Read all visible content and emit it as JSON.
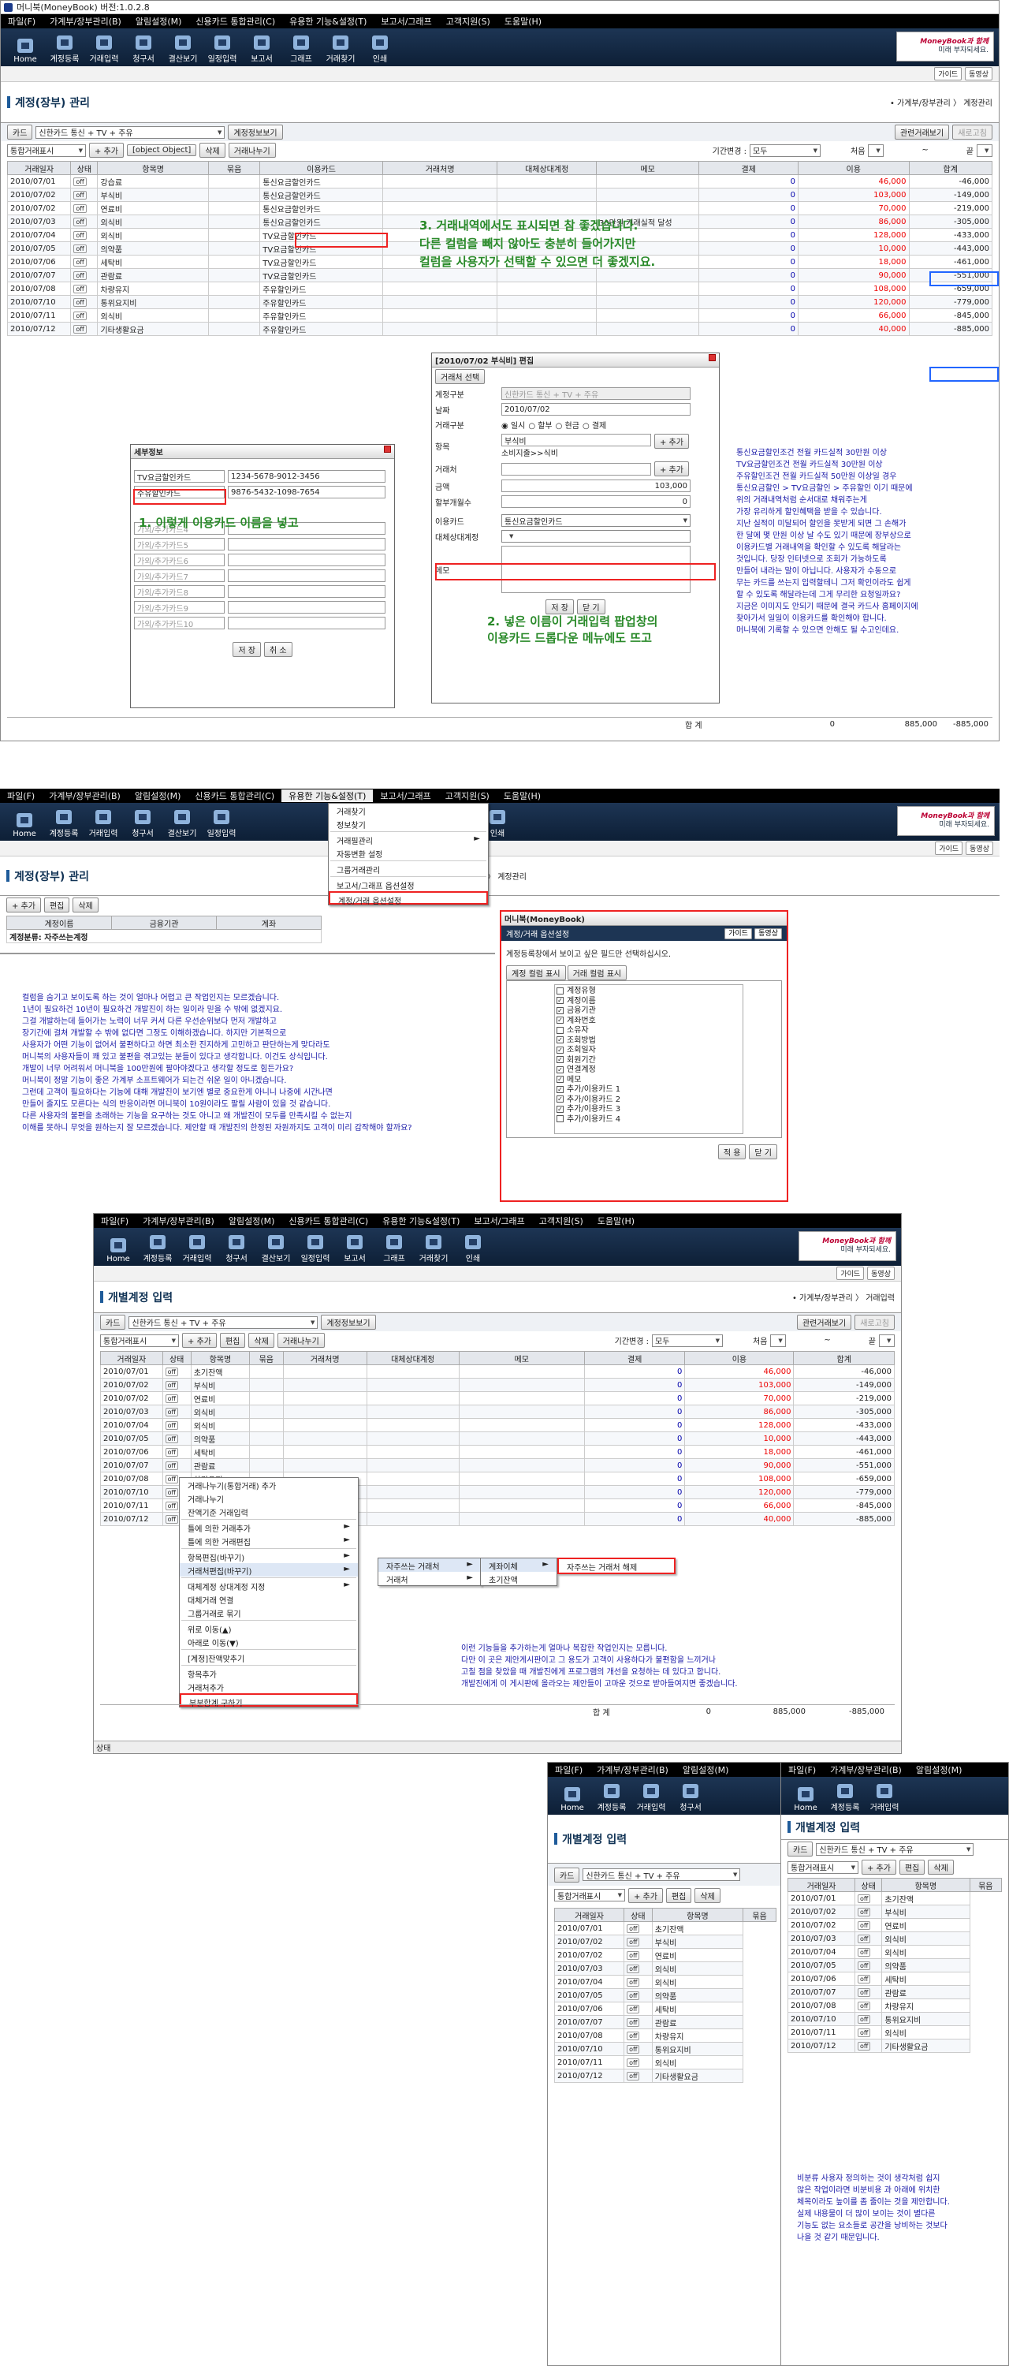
{
  "window_title": "머니북(MoneyBook) 버전:1.0.2.8",
  "menu": [
    "파일(F)",
    "가계부/장부관리(B)",
    "알림설정(M)",
    "신용카드 통합관리(C)",
    "유용한 기능&설정(T)",
    "보고서/그래프",
    "고객지원(S)",
    "도움말(H)"
  ],
  "toolbar": [
    "Home",
    "계정등록",
    "거래입력",
    "청구서",
    "결산보기",
    "일정입력",
    "보고서",
    "그래프",
    "거래찾기",
    "인쇄"
  ],
  "brand": {
    "line1": "MoneyBook과 함께",
    "line2": "미래 부자되세요."
  },
  "subbar": {
    "guide": "가이드",
    "video": "동영상"
  },
  "s1": {
    "title": "계정(장부) 관리",
    "breadcrumb": "• 가계부/장부관리 〉 계정관리",
    "card_btn": "카드",
    "card_select": "신한카드 통신 + TV + 주유",
    "card_view_btn": "계정정보보기",
    "new_btn": "관련거래보기",
    "refresh_btn": "새로고침",
    "filter_select": "통합거래표시",
    "add": "+ 추가",
    "edit": {
      "title": "[2010/07/02 부식비] 편집",
      "tab": "거래처 선택",
      "acct_label": "계정구분",
      "acct_val": "신한카드 통신 + TV + 주유",
      "date_label": "날짜",
      "date_val": "2010/07/02",
      "type_label": "거래구분",
      "types": [
        "일시",
        "할부",
        "현금",
        "결제"
      ],
      "item_label": "항목",
      "item_val": "부식비",
      "item_path": "소비지출>>식비",
      "vendor_label": "거래처",
      "amount_label": "금액",
      "amount_val": "103,000",
      "inst_label": "할부개월수",
      "inst_val": "0",
      "card_label": "이용카드",
      "card_val": "통신요금할인카드",
      "alt_label": "대체상대계정",
      "memo_label": "메모",
      "add": "+ 추가",
      "save": "저 장",
      "close": "닫 기",
      "annot": [
        "2. 넣은 이름이 거래입력 팝업창의",
        "이용카드 드롭다운 메뉴에도 뜨고"
      ]
    },
    "del": "삭제",
    "split": "거래나누기",
    "period_label": "기간변경 :",
    "period_val": "모두",
    "first": "처음",
    "tilde": "~",
    "end": "끝",
    "headers": [
      "거래일자",
      "상태",
      "항목명",
      "묶음",
      "이용카드",
      "거래처명",
      "대체상대계정",
      "메모",
      "결제",
      "이용",
      "합계"
    ],
    "rows": [
      [
        "2010/07/01",
        "off",
        "강습료",
        "",
        "통신요금할인카드",
        "",
        "",
        "",
        "0",
        "46,000",
        "-46,000"
      ],
      [
        "2010/07/02",
        "off",
        "부식비",
        "",
        "통신요금할인카드",
        "",
        "",
        "",
        "0",
        "103,000",
        "-149,000"
      ],
      [
        "2010/07/02",
        "off",
        "연료비",
        "",
        "통신요금할인카드",
        "",
        "",
        "",
        "0",
        "70,000",
        "-219,000"
      ],
      [
        "2010/07/03",
        "off",
        "외식비",
        "",
        "통신요금할인카드",
        "",
        "",
        "30만원 거래실적 달성",
        "0",
        "86,000",
        "-305,000"
      ],
      [
        "2010/07/04",
        "off",
        "외식비",
        "",
        "TV요금할인카드",
        "",
        "",
        "",
        "0",
        "128,000",
        "-433,000"
      ],
      [
        "2010/07/05",
        "off",
        "의약품",
        "",
        "TV요금할인카드",
        "",
        "",
        "",
        "0",
        "10,000",
        "-443,000"
      ],
      [
        "2010/07/06",
        "off",
        "세탁비",
        "",
        "TV요금할인카드",
        "",
        "",
        "",
        "0",
        "18,000",
        "-461,000"
      ],
      [
        "2010/07/07",
        "off",
        "관람료",
        "",
        "TV요금할인카드",
        "",
        "",
        "",
        "0",
        "90,000",
        "-551,000"
      ],
      [
        "2010/07/08",
        "off",
        "차량유지",
        "",
        "주유할인카드",
        "",
        "",
        "",
        "0",
        "108,000",
        "-659,000"
      ],
      [
        "2010/07/10",
        "off",
        "통위요지비",
        "",
        "주유할인카드",
        "",
        "",
        "",
        "0",
        "120,000",
        "-779,000"
      ],
      [
        "2010/07/11",
        "off",
        "외식비",
        "",
        "주유할인카드",
        "",
        "",
        "",
        "0",
        "66,000",
        "-845,000"
      ],
      [
        "2010/07/12",
        "off",
        "기타생활요금",
        "",
        "주유할인카드",
        "",
        "",
        "",
        "0",
        "40,000",
        "-885,000"
      ]
    ],
    "total_label": "합 계",
    "total_pay": "0",
    "total_use": "885,000",
    "total_sum": "-885,000",
    "annot1": [
      "3. 거래내역에서도 표시되면 참 좋겠습니다.",
      "다른 컬럼을 빼지 않아도 충분히 들어가지만",
      "컬럼을 사용자가 선택할 수 있으면 더 좋겠지요."
    ],
    "detail": {
      "title": "세부정보",
      "items": [
        [
          "TV요금할인카드",
          "1234-5678-9012-3456"
        ],
        [
          "주유할인카드",
          "9876-5432-1098-7654"
        ],
        [
          "가외/추가카드4",
          ""
        ],
        [
          "가외/추가카드5",
          ""
        ],
        [
          "가외/추가카드6",
          ""
        ],
        [
          "가외/추가카드7",
          ""
        ],
        [
          "가외/추가카드8",
          ""
        ],
        [
          "가외/추가카드9",
          ""
        ],
        [
          "가외/추가카드10",
          ""
        ]
      ],
      "save": "저 장",
      "cancel": "취 소",
      "annot": "1. 이렇게 이용카드 이름을 넣고"
    },
    "rightnote": [
      "통신요금할인조건 전월 카드실적 30만원 이상",
      "TV요금할인조건 전월 카드실적 30만원 이상",
      "주유할인조건 전월 카드실적 50만원 이상일 경우",
      "통신요금할인 > TV요금할인 > 주유할인 이기 때문에",
      "위의 거래내역처럼 순서대로 채워주는게",
      "가장 유리하게 할인혜택을 받을 수 있습니다.",
      "지난 실적이 미달되어 할인을 못받게 되면 그 손해가",
      "한 달에 몇 만원 이상 날 수도 있기 때문에 장부상으로",
      "이용카드별 거래내역을 확인할 수 있도록 해달라는",
      "것입니다. 당장 인터넷으로 조회가 가능하도록",
      "만들어 내라는 말이 아닙니다. 사용자가 수동으로",
      "무는 카드를 쓰는지 입력할테니 그저 확인이라도 쉽게",
      "할 수 있도록 해달라는데 그게 무리한 요청일까요?",
      "지금은 이미지도 안되기 때문에 결국 카드사 홈페이지에",
      "찾아가서 일일이 이용카드를 확인해야 합니다.",
      "머니북에 기록할 수 있으면 안해도 될 수고인데요."
    ]
  },
  "s2": {
    "title": "계정(장부) 관리",
    "breadcrumb": "• 가계부/장부관리 〉 계정관리",
    "add": "+ 추가",
    "edit": "편집",
    "del": "삭제",
    "headers": [
      "계정이름",
      "금융기관",
      "계좌"
    ],
    "grp": "계정분류: 자주쓰는계정",
    "menu": [
      "거래찾기",
      "정보찾기",
      "거래필관리",
      "자동변환 설정",
      "그룹거래관리",
      "보고서/그래프 옵션설정",
      "계정/거래 옵션설정"
    ],
    "opt": {
      "title": "머니북(MoneyBook)",
      "sub": "계정/거래 옵션설정",
      "guide": "가이드",
      "video": "동영상",
      "desc": "계정등록창에서 보이고 싶은 필드만 선택하십시오.",
      "tabs": [
        "계정 컬럼 표시",
        "거래 컬럼 표시"
      ],
      "items": [
        [
          "계정유형",
          false
        ],
        [
          "계정이름",
          true
        ],
        [
          "금융기관",
          true
        ],
        [
          "계좌번호",
          true
        ],
        [
          "소유자",
          false
        ],
        [
          "조회방법",
          true
        ],
        [
          "조회일자",
          true
        ],
        [
          "회원기간",
          true
        ],
        [
          "연결계정",
          true
        ],
        [
          "메모",
          true
        ],
        [
          "추가/이용카드 1",
          true
        ],
        [
          "추가/이용카드 2",
          true
        ],
        [
          "추가/이용카드 3",
          true
        ],
        [
          "추가/이용카드 4",
          false
        ]
      ],
      "ok": "적 용",
      "close": "닫 기"
    },
    "note": [
      "컬럼을 숨기고 보이도록 하는 것이 얼마나 어렵고 큰 작업인지는 모르겠습니다.",
      "1년이 필요하건 10년이 필요하건 개발진이 하는 일이라 믿을 수 밖에 없겠지요.",
      "그걸 개발하는데 들어가는 노력이 너무 커서 다른 우선순위보다 먼저 개발하고",
      "장기간에 걸쳐 개발할 수 밖에 없다면 그정도 이해하겠습니다. 하지만 기본적으로",
      "사용자가 어떤 기능이 없어서 불편하다고 하면 최소한 진지하게 고민하고 판단하는게 맞다라도",
      "머니북의 사용자들이 꽤 있고 불편을 겪고있는 분들이 있다고 생각합니다. 이건도 상식입니다.",
      "개발이 너무 어려워서 머니북을 100만원에 팔아야겠다고 생각할 정도로 힘든가요?",
      "머니북이 정말 기능이 좋은 가계부 소프트웨어가 되는건 쉬운 일이 아니겠습니다.",
      "그런데 고객이 필요하다는 기능에 대해 개발진이 보기엔 별로 중요한게 아니니 나중에 시간나면",
      "만들어 줄지도 모른다는 식의 반응이라면 머니북이 10원이라도 팔릴 사람이 있을 것 같습니다.",
      "다른 사용자의 불편을 초래하는 기능을 요구하는 것도 아니고 왜 개발진이 모두를 만족시킬 수 없는지",
      "이해를 못하니 무엇을 원하는지 잘 모르겠습니다. 제안할 때 개발진의 한정된 자원까지도 고객이 미리 감작해야 할까요?"
    ]
  },
  "s3": {
    "title": "개별계정 입력",
    "breadcrumb": "• 가계부/장부관리 〉 거래입력",
    "card_btn": "카드",
    "card_select": "신한카드 통신 + TV + 주유",
    "card_view_btn": "계정정보보기",
    "new_btn": "관련거래보기",
    "refresh_btn": "새로고침",
    "filter_select": "통합거래표시",
    "add": "+ 추가",
    "edit": "편집",
    "del": "삭제",
    "split": "거래나누기",
    "period_label": "기간변경 :",
    "period_val": "모두",
    "first": "처음",
    "tilde": "~",
    "end": "끝",
    "headers": [
      "거래일자",
      "상태",
      "항목명",
      "묶음",
      "거래처명",
      "대체상대계정",
      "메모",
      "결제",
      "이용",
      "합계"
    ],
    "rows": [
      [
        "2010/07/01",
        "off",
        "초기잔액",
        "",
        "",
        "",
        "",
        "0",
        "46,000",
        "-46,000"
      ],
      [
        "2010/07/02",
        "off",
        "부식비",
        "",
        "",
        "",
        "",
        "0",
        "103,000",
        "-149,000"
      ],
      [
        "2010/07/02",
        "off",
        "연료비",
        "",
        "",
        "",
        "",
        "0",
        "70,000",
        "-219,000"
      ],
      [
        "2010/07/03",
        "off",
        "외식비",
        "",
        "",
        "",
        "",
        "0",
        "86,000",
        "-305,000"
      ],
      [
        "2010/07/04",
        "off",
        "외식비",
        "",
        "",
        "",
        "",
        "0",
        "128,000",
        "-433,000"
      ],
      [
        "2010/07/05",
        "off",
        "의약품",
        "",
        "",
        "",
        "",
        "0",
        "10,000",
        "-443,000"
      ],
      [
        "2010/07/06",
        "off",
        "세탁비",
        "",
        "",
        "",
        "",
        "0",
        "18,000",
        "-461,000"
      ],
      [
        "2010/07/07",
        "off",
        "관람료",
        "",
        "",
        "",
        "",
        "0",
        "90,000",
        "-551,000"
      ],
      [
        "2010/07/08",
        "off",
        "차량유지",
        "",
        "",
        "",
        "",
        "0",
        "108,000",
        "-659,000"
      ],
      [
        "2010/07/10",
        "off",
        "통위요지비",
        "",
        "",
        "",
        "",
        "0",
        "120,000",
        "-779,000"
      ],
      [
        "2010/07/11",
        "off",
        "외식비",
        "",
        "",
        "",
        "",
        "0",
        "66,000",
        "-845,000"
      ],
      [
        "2010/07/12",
        "off",
        "기타생활요금",
        "",
        "",
        "",
        "",
        "0",
        "40,000",
        "-885,000"
      ]
    ],
    "total_label": "합 계",
    "total_pay": "0",
    "total_use": "885,000",
    "total_sum": "-885,000",
    "ctx": [
      "거래나누기(통합거래) 추가",
      "거래나누기",
      "잔액기준 거래입력",
      "틀에 의한 거래추가",
      "틀에 의한 거래편집",
      "항목편집(바꾸기)",
      "거래처편집(바꾸기)",
      "대체계정 상대계정 지정",
      "대체거래 연결",
      "그룹거래로 묶기",
      "위로 이동(▲)",
      "아래로 이동(▼)",
      "[계정]잔액맞추기",
      "항목추가",
      "거래처추가",
      "부분합계 구하기"
    ],
    "sub1": [
      "자주쓰는 거래처",
      "거래처"
    ],
    "sub2": [
      "계좌이체",
      "초기잔액"
    ],
    "sub3": "자주쓰는 거래처 해제",
    "note": [
      "이런 기능들을 추가하는게 얼마나 복잡한 작업인지는 모릅니다.",
      "다만 이 곳은 제안게시판이고 그 용도가 고객이 사용하다가 불편함을 느끼거나",
      "고칠 점을 찾았을 때 개발진에게 프로그램의 개선을 요청하는 데 있다고 합니다.",
      "개발진에게 이 게시판에 올라오는 제안들이 고마운 것으로 받아들여지면 좋겠습니다."
    ],
    "status": "상태"
  },
  "s4": {
    "title": "개별계정 입력",
    "card_btn": "카드",
    "card_select": "신한카드 통신 + TV + 주유",
    "filter_select": "통합거래표시",
    "add": "+ 추가",
    "edit": "편집",
    "del": "삭제",
    "headers": [
      "거래일자",
      "상태",
      "항목명",
      "묶음"
    ],
    "rows": [
      [
        "2010/07/01",
        "off",
        "초기잔액"
      ],
      [
        "2010/07/02",
        "off",
        "부식비"
      ],
      [
        "2010/07/02",
        "off",
        "연료비"
      ],
      [
        "2010/07/03",
        "off",
        "외식비"
      ],
      [
        "2010/07/04",
        "off",
        "외식비"
      ],
      [
        "2010/07/05",
        "off",
        "의약품"
      ],
      [
        "2010/07/06",
        "off",
        "세탁비"
      ],
      [
        "2010/07/07",
        "off",
        "관람료"
      ],
      [
        "2010/07/08",
        "off",
        "차량유지"
      ],
      [
        "2010/07/10",
        "off",
        "통위요지비"
      ],
      [
        "2010/07/11",
        "off",
        "외식비"
      ],
      [
        "2010/07/12",
        "off",
        "기타생활요금"
      ]
    ]
  },
  "s5": {
    "title": "개별계정 입력",
    "card_btn": "카드",
    "card_select": "신한카드 통신 + TV + 주유",
    "filter_select": "통합거래표시",
    "add": "+ 추가",
    "edit": "편집",
    "del": "삭제",
    "headers": [
      "거래일자",
      "상태",
      "항목명",
      "묶음"
    ],
    "rows": [
      [
        "2010/07/01",
        "off",
        "초기잔액"
      ],
      [
        "2010/07/02",
        "off",
        "부식비"
      ],
      [
        "2010/07/02",
        "off",
        "연료비"
      ],
      [
        "2010/07/03",
        "off",
        "외식비"
      ],
      [
        "2010/07/04",
        "off",
        "외식비"
      ],
      [
        "2010/07/05",
        "off",
        "의약품"
      ],
      [
        "2010/07/06",
        "off",
        "세탁비"
      ],
      [
        "2010/07/07",
        "off",
        "관람료"
      ],
      [
        "2010/07/08",
        "off",
        "차량유지"
      ],
      [
        "2010/07/10",
        "off",
        "통위요지비"
      ],
      [
        "2010/07/11",
        "off",
        "외식비"
      ],
      [
        "2010/07/12",
        "off",
        "기타생활요금"
      ]
    ],
    "note": [
      "비분류 사용자 정의하는 것이 생각처럼 쉽지",
      "않은 작업이라면 비분비용 과 아래에 위치한",
      "체목이라도 높이를 좀 줄이는 것을 제안합니다.",
      "실제 내용물이 더 많이 보이는 것이 별다른",
      "기능도 없는 요소들로 공간을 낭비하는 것보다",
      "나을 것 같기 때문입니다."
    ]
  }
}
